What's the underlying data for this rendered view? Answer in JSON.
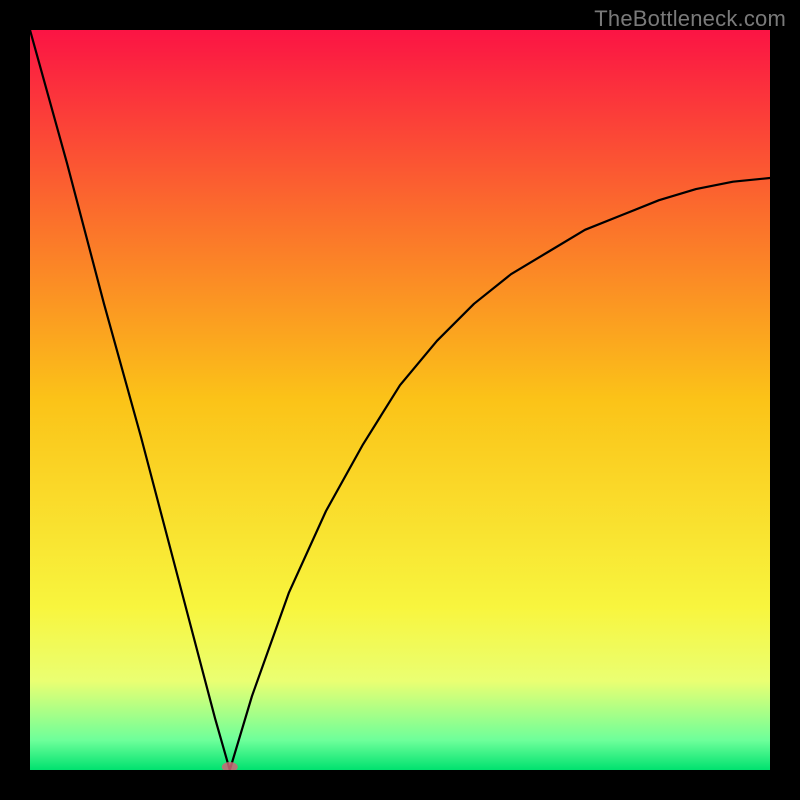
{
  "watermark": {
    "text": "TheBottleneck.com"
  },
  "chart_data": {
    "type": "line",
    "title": "",
    "xlabel": "",
    "ylabel": "",
    "xlim": [
      0,
      100
    ],
    "ylim": [
      0,
      100
    ],
    "grid": false,
    "legend": false,
    "annotation": "Bottleneck percentage vs performance axis — V-shaped curve with minimum (optimal point) near x ≈ 27; left branch steep and approximately linear descending from ~100% at x=0 to 0% at x≈27; right branch rises with decreasing slope reaching ~80% at x=100.",
    "minimum_marker": {
      "x": 27,
      "y": 0,
      "color": "#cc6677"
    },
    "gradient_stops": [
      {
        "offset": 0.0,
        "color": "#fb1444"
      },
      {
        "offset": 0.25,
        "color": "#fb6e2c"
      },
      {
        "offset": 0.5,
        "color": "#fbc318"
      },
      {
        "offset": 0.78,
        "color": "#f8f53e"
      },
      {
        "offset": 0.88,
        "color": "#eaff72"
      },
      {
        "offset": 0.96,
        "color": "#6dff9a"
      },
      {
        "offset": 1.0,
        "color": "#00e26f"
      }
    ],
    "series": [
      {
        "name": "bottleneck-curve",
        "x": [
          0,
          5,
          10,
          15,
          20,
          25,
          27,
          30,
          35,
          40,
          45,
          50,
          55,
          60,
          65,
          70,
          75,
          80,
          85,
          90,
          95,
          100
        ],
        "y": [
          100,
          82,
          63,
          45,
          26,
          7,
          0,
          10,
          24,
          35,
          44,
          52,
          58,
          63,
          67,
          70,
          73,
          75,
          77,
          78.5,
          79.5,
          80
        ]
      }
    ]
  }
}
